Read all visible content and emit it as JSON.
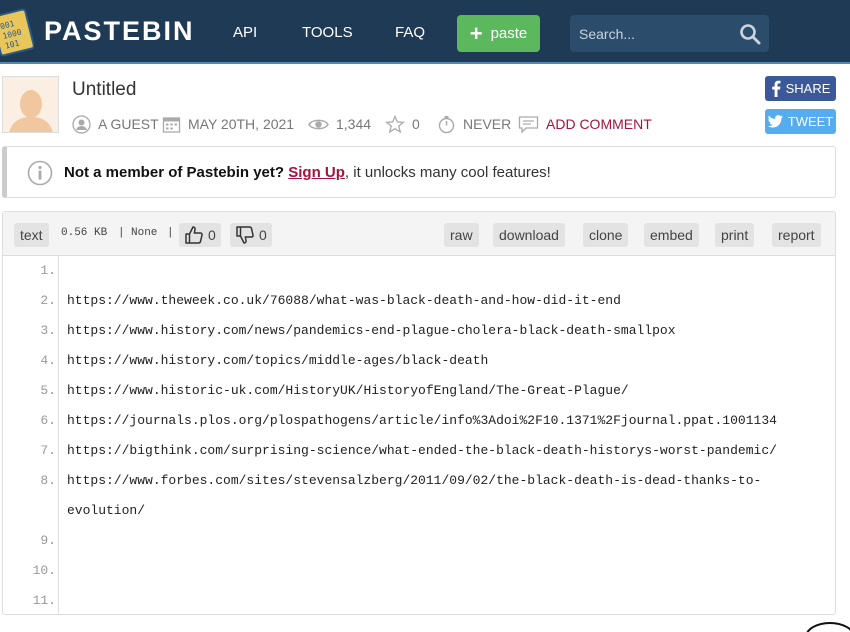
{
  "header": {
    "brand": "PASTEBIN",
    "nav": [
      "API",
      "TOOLS",
      "FAQ"
    ],
    "paste_label": "paste",
    "search_placeholder": "Search..."
  },
  "post": {
    "title": "Untitled",
    "author": "A GUEST",
    "date": "MAY 20TH, 2021",
    "views": "1,344",
    "rating": "0",
    "expires": "NEVER",
    "add_comment": "ADD COMMENT"
  },
  "share": {
    "facebook": "SHARE",
    "twitter": "TWEET"
  },
  "notice": {
    "prefix": "Not a member of Pastebin yet?",
    "signup": "Sign Up",
    "suffix": ", it unlocks many cool features!"
  },
  "toolbar": {
    "syntax": "text",
    "size": "0.56 KB",
    "separator": "|",
    "category": "None",
    "likes": "0",
    "dislikes": "0",
    "buttons": [
      "raw",
      "download",
      "clone",
      "embed",
      "print",
      "report"
    ]
  },
  "code": {
    "line_numbers": [
      "1.",
      "2.",
      "3.",
      "4.",
      "5.",
      "6.",
      "7.",
      "8.",
      "9.",
      "10.",
      "11."
    ],
    "lines": [
      "",
      "https://www.theweek.co.uk/76088/what-was-black-death-and-how-did-it-end",
      "https://www.history.com/news/pandemics-end-plague-cholera-black-death-smallpox",
      "https://www.history.com/topics/middle-ages/black-death",
      "https://www.historic-uk.com/HistoryUK/HistoryofEngland/The-Great-Plague/",
      "https://journals.plos.org/plospathogens/article/info%3Adoi%2F10.1371%2Fjournal.ppat.1001134",
      "https://bigthink.com/surprising-science/what-ended-the-black-death-historys-worst-pandemic/",
      "https://www.forbes.com/sites/stevensalzberg/2011/09/02/the-black-death-is-dead-thanks-to-",
      "evolution/",
      "",
      ""
    ]
  },
  "colors": {
    "header_bg": "#1f3a55",
    "paste_green": "#5cb85c",
    "accent_red": "#a5133b",
    "facebook": "#3b5998",
    "twitter": "#55acee"
  }
}
